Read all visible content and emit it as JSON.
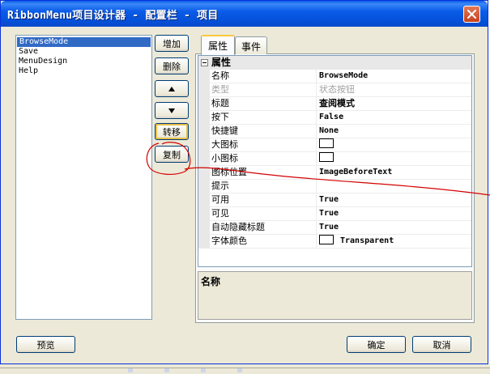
{
  "window": {
    "title": "RibbonMenu项目设计器 - 配置栏 - 项目"
  },
  "list": {
    "items": [
      "BrowseMode",
      "Save",
      "MenuDesign",
      "Help"
    ],
    "selected": 0
  },
  "side_buttons": {
    "add": "增加",
    "delete": "删除",
    "up_icon": "arrow-up-icon",
    "down_icon": "arrow-down-icon",
    "move": "转移",
    "copy": "复制"
  },
  "tabs": [
    {
      "label": "属性"
    },
    {
      "label": "事件"
    }
  ],
  "grid": {
    "category": "属性",
    "rows": [
      {
        "name": "名称",
        "value": "BrowseMode"
      },
      {
        "name": "类型",
        "value": "状态按钮"
      },
      {
        "name": "标题",
        "value": "查阅模式"
      },
      {
        "name": "按下",
        "value": "False"
      },
      {
        "name": "快捷键",
        "value": "None"
      },
      {
        "name": "大图标",
        "value": ""
      },
      {
        "name": "小图标",
        "value": ""
      },
      {
        "name": "图标位置",
        "value": "ImageBeforeText"
      },
      {
        "name": "提示",
        "value": ""
      },
      {
        "name": "可用",
        "value": "True"
      },
      {
        "name": "可见",
        "value": "True"
      },
      {
        "name": "自动隐藏标题",
        "value": "True"
      },
      {
        "name": "字体颜色",
        "value": "Transparent"
      }
    ]
  },
  "description": {
    "title": "名称"
  },
  "footer": {
    "preview": "预览",
    "ok": "确定",
    "cancel": "取消"
  },
  "colors": {
    "titlebar": "#0a5ce8",
    "selection": "#316ac5",
    "annotation": "#d40000"
  }
}
